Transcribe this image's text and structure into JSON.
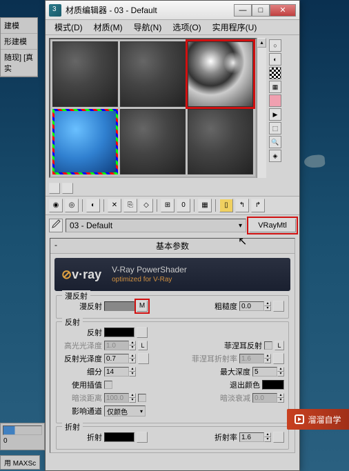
{
  "left_panel": {
    "item0": "建模",
    "item1": "形建模",
    "item2": "随现]  [真实"
  },
  "window": {
    "title": "材质编辑器 - 03 - Default"
  },
  "menu": {
    "mode": "模式(D)",
    "material": "材质(M)",
    "navigation": "导航(N)",
    "options": "选项(O)",
    "utilities": "实用程序(U)"
  },
  "material": {
    "name": "03 - Default",
    "type": "VRayMtl"
  },
  "rollup": {
    "basic_params": "基本参数"
  },
  "vray": {
    "brand": "v·ray",
    "title": "V-Ray PowerShader",
    "subtitle": "optimized for V-Ray"
  },
  "diffuse": {
    "legend": "漫反射",
    "label": "漫反射",
    "map_indicator": "M",
    "roughness_label": "粗糙度",
    "roughness_value": "0.0"
  },
  "reflect": {
    "legend": "反射",
    "label": "反射",
    "hilight_gloss_label": "高光光泽度",
    "hilight_gloss_value": "1.0",
    "refl_gloss_label": "反射光泽度",
    "refl_gloss_value": "0.7",
    "subdivs_label": "细分",
    "subdivs_value": "14",
    "use_interp_label": "使用插值",
    "dim_distance_label": "暗淡距离",
    "dim_distance_value": "100.0",
    "affect_channels_label": "影响通道",
    "affect_channels_value": "仅颜色",
    "fresnel_label": "菲涅耳反射",
    "fresnel_ior_label": "菲涅耳折射率",
    "fresnel_ior_value": "1.6",
    "max_depth_label": "最大深度",
    "max_depth_value": "5",
    "exit_color_label": "退出颜色",
    "dim_falloff_label": "暗淡衰减",
    "dim_falloff_value": "0.0",
    "lock_l": "L"
  },
  "refract": {
    "legend": "折射",
    "label": "折射",
    "ior_label": "折射率",
    "ior_value": "1.6"
  },
  "timeline": {
    "num": "0"
  },
  "watermark": {
    "text": "溜溜自学"
  },
  "bottom": {
    "status1": "用 MAXSc"
  }
}
